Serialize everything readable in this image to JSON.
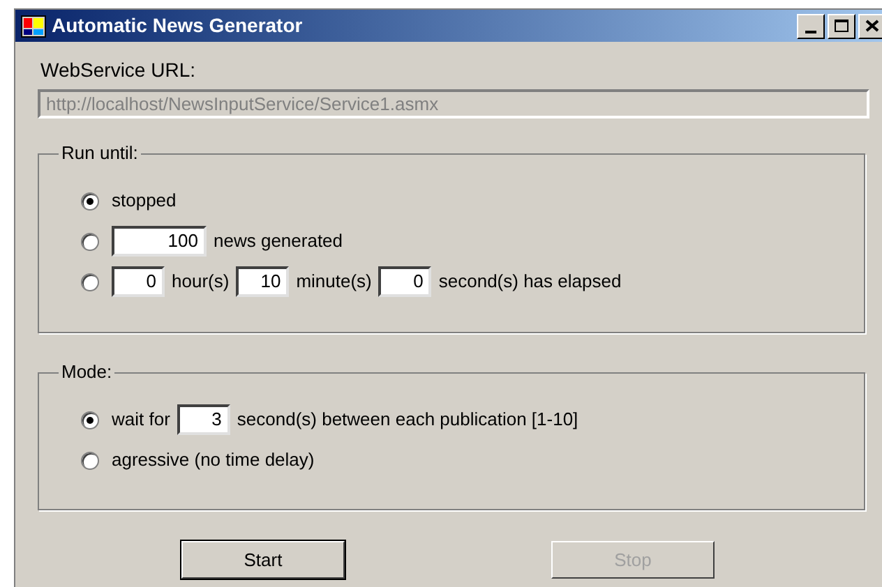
{
  "window": {
    "title": "Automatic News Generator"
  },
  "url": {
    "label": "WebService URL:",
    "value": "http://localhost/NewsInputService/Service1.asmx",
    "disabled": true
  },
  "groups": [
    {
      "title": "Run until:",
      "options": [
        {
          "selected": true,
          "parts": [
            {
              "kind": "text",
              "text": "stopped"
            }
          ]
        },
        {
          "selected": false,
          "parts": [
            {
              "kind": "field",
              "value": "100"
            },
            {
              "kind": "text",
              "text": "news generated"
            }
          ]
        },
        {
          "selected": false,
          "parts": [
            {
              "kind": "field",
              "value": "0"
            },
            {
              "kind": "text",
              "text": "hour(s)"
            },
            {
              "kind": "field",
              "value": "10"
            },
            {
              "kind": "text",
              "text": "minute(s)"
            },
            {
              "kind": "field",
              "value": "0"
            },
            {
              "kind": "text",
              "text": "second(s) has elapsed"
            }
          ]
        }
      ]
    },
    {
      "title": "Mode:",
      "options": [
        {
          "selected": true,
          "parts": [
            {
              "kind": "text",
              "text": "wait for"
            },
            {
              "kind": "field",
              "value": "3"
            },
            {
              "kind": "text",
              "text": "second(s) between each publication [1-10]"
            }
          ]
        },
        {
          "selected": false,
          "parts": [
            {
              "kind": "text",
              "text": "agressive (no time delay)"
            }
          ]
        }
      ]
    }
  ],
  "buttons": [
    {
      "label": "Start",
      "disabled": false
    },
    {
      "label": "Stop",
      "disabled": true
    }
  ]
}
